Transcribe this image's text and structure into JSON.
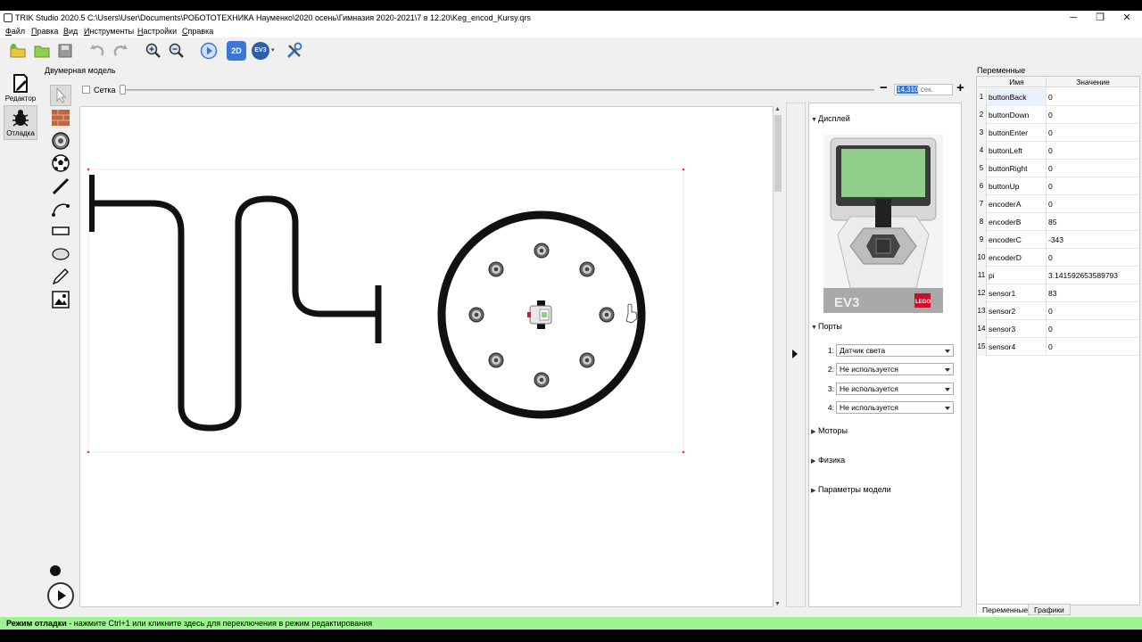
{
  "window": {
    "title": "TRIK Studio 2020.5 C:\\Users\\User\\Documents\\РОБОТОТЕХНИКА Науменко\\2020 осень\\Гимназия 2020-2021\\7 в 12.20\\Keg_encod_Kursy.qrs",
    "minimize": "─",
    "maximize": "❐",
    "close": "✕"
  },
  "menu": [
    {
      "first": "Ф",
      "rest": "айл"
    },
    {
      "first": "П",
      "rest": "равка"
    },
    {
      "first": "В",
      "rest": "ид"
    },
    {
      "first": "И",
      "rest": "нструменты"
    },
    {
      "first": "Н",
      "rest": "астройки"
    },
    {
      "first": "С",
      "rest": "правка"
    }
  ],
  "toolbar": {
    "mode_2d": "2D",
    "mode_ev3": "EV3"
  },
  "modes": {
    "editor": "Редактор",
    "debug": "Отладка"
  },
  "model": {
    "title": "Двумерная модель",
    "grid_label": "Сетка",
    "slider_value": 0.0,
    "zoom_minus": "−",
    "zoom_plus": "+",
    "time_value": "14,310",
    "time_unit": " сек."
  },
  "properties": {
    "display": "Дисплей",
    "ports_title": "Порты",
    "ports": [
      {
        "num": "1:",
        "value": "Датчик света"
      },
      {
        "num": "2:",
        "value": "Не используется"
      },
      {
        "num": "3:",
        "value": "Не используется"
      },
      {
        "num": "4:",
        "value": "Не используется"
      }
    ],
    "motors": "Моторы",
    "physics": "Физика",
    "model_params": "Параметры модели",
    "ev3_label": "EV3",
    "lego_label": "LEGO"
  },
  "variables": {
    "title": "Переменные",
    "col_name": "Имя",
    "col_value": "Значение",
    "rows": [
      {
        "i": "1",
        "name": "buttonBack",
        "value": "0"
      },
      {
        "i": "2",
        "name": "buttonDown",
        "value": "0"
      },
      {
        "i": "3",
        "name": "buttonEnter",
        "value": "0"
      },
      {
        "i": "4",
        "name": "buttonLeft",
        "value": "0"
      },
      {
        "i": "5",
        "name": "buttonRight",
        "value": "0"
      },
      {
        "i": "6",
        "name": "buttonUp",
        "value": "0"
      },
      {
        "i": "7",
        "name": "encoderA",
        "value": "0"
      },
      {
        "i": "8",
        "name": "encoderB",
        "value": "85"
      },
      {
        "i": "9",
        "name": "encoderC",
        "value": "-343"
      },
      {
        "i": "10",
        "name": "encoderD",
        "value": "0"
      },
      {
        "i": "11",
        "name": "pi",
        "value": "3.141592653589793"
      },
      {
        "i": "12",
        "name": "sensor1",
        "value": "83"
      },
      {
        "i": "13",
        "name": "sensor2",
        "value": "0"
      },
      {
        "i": "14",
        "name": "sensor3",
        "value": "0"
      },
      {
        "i": "15",
        "name": "sensor4",
        "value": "0"
      }
    ],
    "tab_vars": "Переменные",
    "tab_graphs": "Графики"
  },
  "status": {
    "bold": "Режим отладки",
    "rest": " - нажмите Ctrl+1 или кликните здесь для переключения в режим редактирования"
  },
  "colors": {
    "status_bg": "#9df58f",
    "accent": "#3b78d6",
    "ev3_screen": "#8fcf8a"
  }
}
